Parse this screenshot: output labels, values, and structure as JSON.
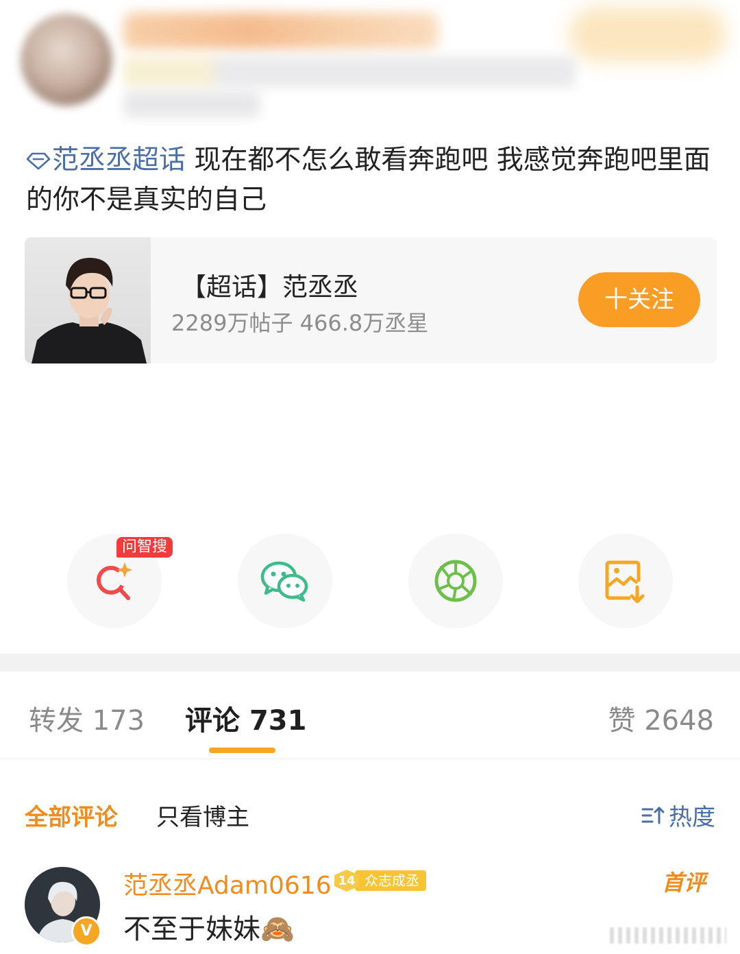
{
  "post": {
    "topic": "范丞丞超话",
    "text": " 现在都不怎么敢看奔跑吧 我感觉奔跑吧里面的你不是真实的自己"
  },
  "supertopic_card": {
    "title": "【超话】范丞丞",
    "stats": "2289万帖子 466.8万丞星",
    "follow_label": "十关注"
  },
  "share": {
    "ai_search_tag": "问智搜",
    "icons": [
      "ai-search-icon",
      "wechat-icon",
      "moments-icon",
      "save-image-icon"
    ]
  },
  "tabs": [
    {
      "label": "转发",
      "count": "173"
    },
    {
      "label": "评论",
      "count": "731"
    },
    {
      "label": "赞",
      "count": "2648"
    }
  ],
  "comment_filters": {
    "all": "全部评论",
    "host_only": "只看博主",
    "sort": "热度"
  },
  "comments": [
    {
      "user": "范丞丞Adam0616",
      "fan_level": "14",
      "fan_badge": "众志成丞",
      "verified_mark": "V",
      "tag": "首评",
      "text": "不至于妹妹🙈"
    }
  ],
  "colors": {
    "accent_orange": "#fa9d24",
    "link_blue": "#4a6ea8",
    "tab_underline": "#f5a623"
  }
}
